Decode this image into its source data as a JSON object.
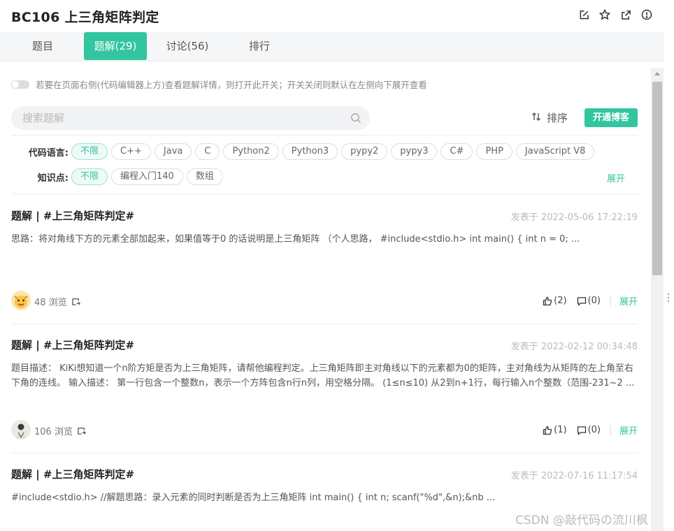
{
  "header": {
    "title": "BC106  上三角矩阵判定"
  },
  "tabs": [
    "题目",
    "题解(29)",
    "讨论(56)",
    "排行"
  ],
  "switch_text": "若要在页面右侧(代码编辑器上方)查看题解详情，则打开此开关；开关关闭则默认在左侧向下展开查看",
  "search": {
    "placeholder": "搜索题解"
  },
  "sort_label": "排序",
  "blog_button": "开通博客",
  "filters": {
    "language": {
      "label": "代码语言:",
      "options": [
        "不限",
        "C++",
        "Java",
        "C",
        "Python2",
        "Python3",
        "pypy2",
        "pypy3",
        "C#",
        "PHP",
        "JavaScript V8"
      ]
    },
    "knowledge": {
      "label": "知识点:",
      "options": [
        "不限",
        "编程入门140",
        "数组"
      ],
      "expand": "展开"
    }
  },
  "posts": [
    {
      "title": "题解 | #上三角矩阵判定#",
      "date": "发表于 2022-05-06 17:22:19",
      "body": "思路：将对角线下方的元素全部加起来，如果值等于0 的话说明是上三角矩阵 （个人思路， #include<stdio.h> int main() {     int n = 0;     ...",
      "views": "48 浏览",
      "likes": "(2)",
      "comments": "(0)",
      "expand": "展开"
    },
    {
      "title": "题解 | #上三角矩阵判定#",
      "date": "发表于 2022-02-12 00:34:48",
      "body": "题目描述： KiKi想知道一个n阶方矩是否为上三角矩阵，请帮他编程判定。上三角矩阵即主对角线以下的元素都为0的矩阵，主对角线为从矩阵的左上角至右下角的连线。 输入描述： 第一行包含一个整数n，表示一个方阵包含n行n列，用空格分隔。 (1≤n≤10) 从2到n+1行，每行输入n个整数（范围-231~2 ...",
      "views": "106 浏览",
      "likes": "(1)",
      "comments": "(0)",
      "expand": "展开"
    },
    {
      "title": "题解 | #上三角矩阵判定#",
      "date": "发表于 2022-07-16 11:17:54",
      "body": "#include<stdio.h> //解题思路：录入元素的同时判断是否为上三角矩阵 int main() {     int n;     scanf(\"%d\",&n);&nb ..."
    }
  ],
  "watermark": "CSDN @敲代码の流川枫",
  "colors": {
    "accent": "#32c5a0"
  }
}
